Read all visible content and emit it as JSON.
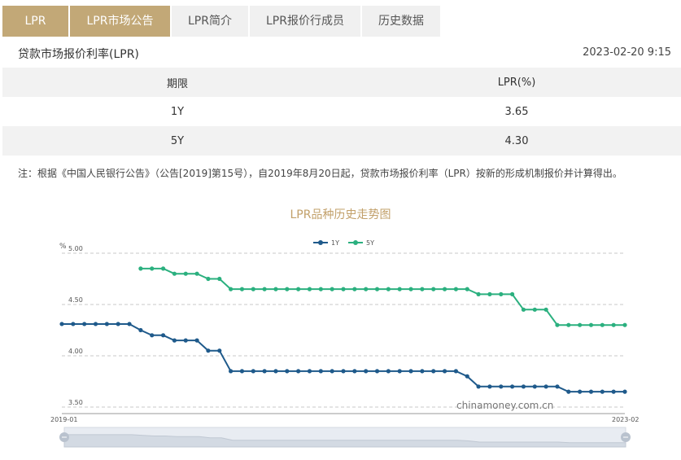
{
  "tabs": [
    {
      "label": "LPR"
    },
    {
      "label": "LPR市场公告"
    },
    {
      "label": "LPR简介"
    },
    {
      "label": "LPR报价行成员"
    },
    {
      "label": "历史数据"
    }
  ],
  "header": {
    "title": "贷款市场报价利率(LPR)",
    "timestamp": "2023-02-20 9:15"
  },
  "table": {
    "headers": [
      "期限",
      "LPR(%)"
    ],
    "rows": [
      {
        "term": "1Y",
        "rate": "3.65"
      },
      {
        "term": "5Y",
        "rate": "4.30"
      }
    ]
  },
  "note": "注：根据《中国人民银行公告》（公告[2019]第15号），自2019年8月20日起，贷款市场报价利率（LPR）按新的形成机制报价并计算得出。",
  "chart_data": {
    "type": "line",
    "title": "LPR品种历史走势图",
    "y_unit_label": "%",
    "ylim": [
      3.5,
      5.0
    ],
    "yticks": [
      "5.00",
      "4.50",
      "4.00",
      "3.50"
    ],
    "x_range_labels": [
      "2019-01",
      "2023-02"
    ],
    "grid": true,
    "legend_position": "top-center",
    "watermark": "chinamoney.com.cn",
    "colors": {
      "1Y": "#1f5a8b",
      "5Y": "#2bb07f"
    },
    "series": [
      {
        "name": "1Y",
        "values": [
          4.31,
          4.31,
          4.31,
          4.31,
          4.31,
          4.31,
          4.31,
          4.25,
          4.2,
          4.2,
          4.15,
          4.15,
          4.15,
          4.05,
          4.05,
          3.85,
          3.85,
          3.85,
          3.85,
          3.85,
          3.85,
          3.85,
          3.85,
          3.85,
          3.85,
          3.85,
          3.85,
          3.85,
          3.85,
          3.85,
          3.85,
          3.85,
          3.85,
          3.85,
          3.85,
          3.85,
          3.8,
          3.7,
          3.7,
          3.7,
          3.7,
          3.7,
          3.7,
          3.7,
          3.7,
          3.65,
          3.65,
          3.65,
          3.65,
          3.65,
          3.65
        ]
      },
      {
        "name": "5Y",
        "values": [
          null,
          null,
          null,
          null,
          null,
          null,
          null,
          4.85,
          4.85,
          4.85,
          4.8,
          4.8,
          4.8,
          4.75,
          4.75,
          4.65,
          4.65,
          4.65,
          4.65,
          4.65,
          4.65,
          4.65,
          4.65,
          4.65,
          4.65,
          4.65,
          4.65,
          4.65,
          4.65,
          4.65,
          4.65,
          4.65,
          4.65,
          4.65,
          4.65,
          4.65,
          4.65,
          4.6,
          4.6,
          4.6,
          4.6,
          4.45,
          4.45,
          4.45,
          4.3,
          4.3,
          4.3,
          4.3,
          4.3,
          4.3,
          4.3
        ]
      }
    ]
  }
}
